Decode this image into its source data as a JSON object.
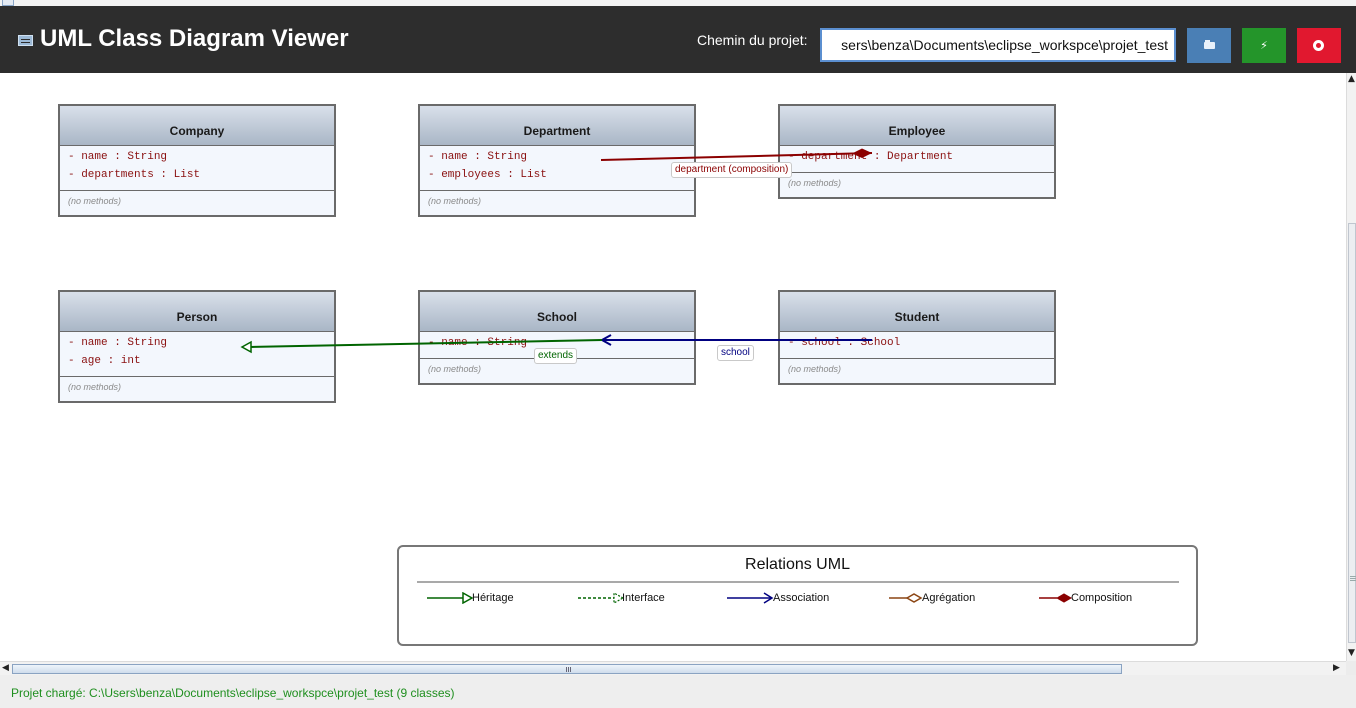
{
  "app": {
    "title": "UML Class Diagram Viewer"
  },
  "toolbar": {
    "path_label": "Chemin du projet:",
    "path_value": "sers\\benza\\Documents\\eclipse_workspce\\projet_test",
    "buttons": {
      "open_icon": "folder-icon",
      "generate_icon": "lightning-icon",
      "close_icon": "power-icon"
    },
    "colors": {
      "open": "#4a7fb5",
      "generate": "#24952a",
      "close": "#e1182f",
      "header_bg": "#2d2d2d"
    }
  },
  "classes": {
    "company": {
      "name": "Company",
      "attrs": [
        "- name : String",
        "- departments : List"
      ],
      "methods": "(no methods)"
    },
    "department": {
      "name": "Department",
      "attrs": [
        "- name : String",
        "- employees : List"
      ],
      "methods": "(no methods)"
    },
    "employee": {
      "name": "Employee",
      "attrs": [
        "- department : Department"
      ],
      "methods": "(no methods)"
    },
    "person": {
      "name": "Person",
      "attrs": [
        "- name : String",
        "- age : int"
      ],
      "methods": "(no methods)"
    },
    "school": {
      "name": "School",
      "attrs": [
        "- name : String"
      ],
      "methods": "(no methods)"
    },
    "student": {
      "name": "Student",
      "attrs": [
        "- school : School"
      ],
      "methods": "(no methods)"
    }
  },
  "relations": {
    "department_composition": {
      "label": "department (composition)",
      "color": "#8b0000"
    },
    "school_association": {
      "label": "school",
      "color": "#000080"
    },
    "school_extends": {
      "label": "extends",
      "color": "#006400"
    }
  },
  "legend": {
    "title": "Relations UML",
    "items": {
      "inheritance": {
        "label": "Héritage",
        "color": "#006400"
      },
      "interface": {
        "label": "Interface",
        "color": "#006400"
      },
      "association": {
        "label": "Association",
        "color": "#000080"
      },
      "aggregation": {
        "label": "Agrégation",
        "color": "#8b4513"
      },
      "composition": {
        "label": "Composition",
        "color": "#8b0000"
      }
    }
  },
  "status": {
    "text": "Projet chargé: C:\\Users\\benza\\Documents\\eclipse_workspce\\projet_test (9 classes)"
  }
}
